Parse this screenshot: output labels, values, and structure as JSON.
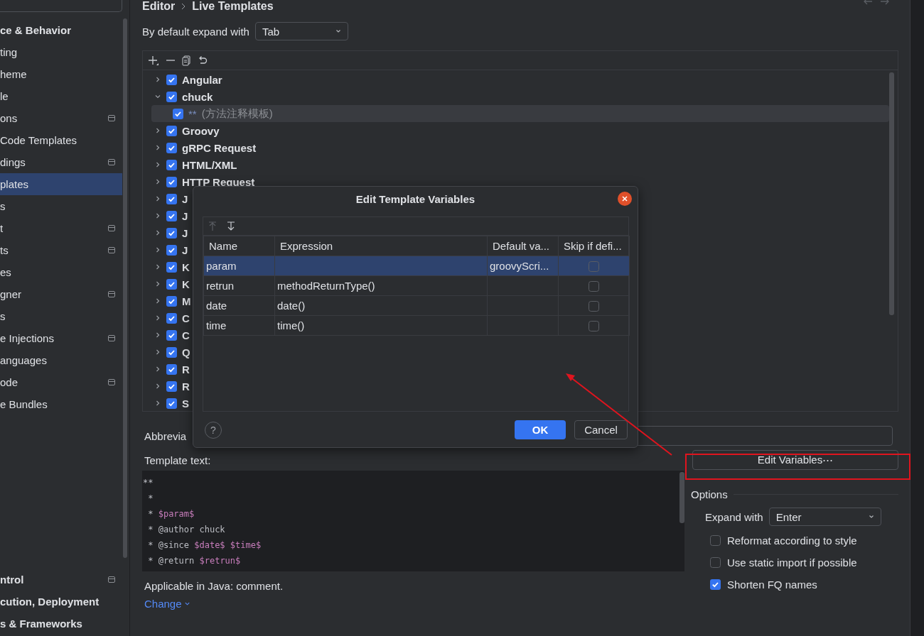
{
  "sidebar": {
    "items": [
      {
        "label": "ce & Behavior",
        "kind": "section",
        "scoped": false,
        "selected": false
      },
      {
        "label": "ting",
        "kind": "item",
        "scoped": false,
        "selected": false
      },
      {
        "label": "heme",
        "kind": "item",
        "scoped": false,
        "selected": false
      },
      {
        "label": "le",
        "kind": "item",
        "scoped": false,
        "selected": false
      },
      {
        "label": "ons",
        "kind": "item",
        "scoped": true,
        "selected": false
      },
      {
        "label": "Code Templates",
        "kind": "item",
        "scoped": false,
        "selected": false
      },
      {
        "label": "dings",
        "kind": "item",
        "scoped": true,
        "selected": false
      },
      {
        "label": "plates",
        "kind": "item",
        "scoped": false,
        "selected": true
      },
      {
        "label": "s",
        "kind": "item",
        "scoped": false,
        "selected": false
      },
      {
        "label": "t",
        "kind": "item",
        "scoped": true,
        "selected": false
      },
      {
        "label": "ts",
        "kind": "item",
        "scoped": true,
        "selected": false
      },
      {
        "label": "es",
        "kind": "item",
        "scoped": false,
        "selected": false
      },
      {
        "label": "gner",
        "kind": "item",
        "scoped": true,
        "selected": false
      },
      {
        "label": "s",
        "kind": "item",
        "scoped": false,
        "selected": false
      },
      {
        "label": "e Injections",
        "kind": "item",
        "scoped": true,
        "selected": false
      },
      {
        "label": "anguages",
        "kind": "item",
        "scoped": false,
        "selected": false
      },
      {
        "label": "ode",
        "kind": "item",
        "scoped": true,
        "selected": false
      },
      {
        "label": "e Bundles",
        "kind": "item",
        "scoped": false,
        "selected": false
      }
    ],
    "footer_items": [
      {
        "label": "ntrol",
        "kind": "section",
        "scoped": true,
        "selected": false
      },
      {
        "label": "cution, Deployment",
        "kind": "section",
        "scoped": false,
        "selected": false
      },
      {
        "label": "s & Frameworks",
        "kind": "section",
        "scoped": false,
        "selected": false
      }
    ]
  },
  "breadcrumb": [
    "Editor",
    "Live Templates"
  ],
  "expand_default": {
    "label": "By default expand with",
    "value": "Tab"
  },
  "tree": {
    "groups": [
      {
        "label": "Angular",
        "checked": true,
        "expanded": false
      },
      {
        "label": "chuck",
        "checked": true,
        "expanded": true,
        "children": [
          {
            "abbreviation": "**",
            "description": "(方法注释模板)",
            "checked": true,
            "selected": true
          }
        ]
      },
      {
        "label": "Groovy",
        "checked": true,
        "expanded": false
      },
      {
        "label": "gRPC Request",
        "checked": true,
        "expanded": false
      },
      {
        "label": "HTML/XML",
        "checked": true,
        "expanded": false
      },
      {
        "label": "HTTP Request",
        "checked": true,
        "expanded": false
      },
      {
        "label": "J",
        "checked": true,
        "expanded": false
      },
      {
        "label": "J",
        "checked": true,
        "expanded": false
      },
      {
        "label": "J",
        "checked": true,
        "expanded": false
      },
      {
        "label": "J",
        "checked": true,
        "expanded": false
      },
      {
        "label": "K",
        "checked": true,
        "expanded": false
      },
      {
        "label": "K",
        "checked": true,
        "expanded": false
      },
      {
        "label": "M",
        "checked": true,
        "expanded": false
      },
      {
        "label": "C",
        "checked": true,
        "expanded": false
      },
      {
        "label": "C",
        "checked": true,
        "expanded": false
      },
      {
        "label": "Q",
        "checked": true,
        "expanded": false
      },
      {
        "label": "R",
        "checked": true,
        "expanded": false
      },
      {
        "label": "R",
        "checked": true,
        "expanded": false
      },
      {
        "label": "S",
        "checked": true,
        "expanded": false
      }
    ]
  },
  "abbreviation": {
    "label": "Abbrevia"
  },
  "template_text": {
    "label": "Template text:",
    "lines": [
      [
        {
          "kind": "text",
          "text": "**"
        }
      ],
      [
        {
          "kind": "text",
          "text": " *"
        }
      ],
      [
        {
          "kind": "text",
          "text": " * "
        },
        {
          "kind": "variable",
          "text": "$param$"
        }
      ],
      [
        {
          "kind": "text",
          "text": " * @author chuck"
        }
      ],
      [
        {
          "kind": "text",
          "text": " * @since "
        },
        {
          "kind": "variable",
          "text": "$date$"
        },
        {
          "kind": "variable",
          "text": " $time$"
        }
      ],
      [
        {
          "kind": "text",
          "text": " * @return "
        },
        {
          "kind": "variable",
          "text": "$retrun$"
        }
      ]
    ]
  },
  "applicable": "Applicable in Java: comment.",
  "change_link": "Change",
  "edit_variables_button": "Edit Variables⋯",
  "options": {
    "title": "Options",
    "expand_with": {
      "label": "Expand with",
      "value": "Enter"
    },
    "checkboxes": [
      {
        "label": "Reformat according to style",
        "checked": false
      },
      {
        "label": "Use static import if possible",
        "checked": false
      },
      {
        "label": "Shorten FQ names",
        "checked": true
      }
    ]
  },
  "dialog": {
    "title": "Edit Template Variables",
    "columns": [
      "Name",
      "Expression",
      "Default va...",
      "Skip if defi..."
    ],
    "rows": [
      {
        "name": "param",
        "expression": "",
        "default_value": "groovyScri...",
        "skip_if_defined": false,
        "selected": true
      },
      {
        "name": "retrun",
        "expression": "methodReturnType()",
        "default_value": "",
        "skip_if_defined": false,
        "selected": false
      },
      {
        "name": "date",
        "expression": "date()",
        "default_value": "",
        "skip_if_defined": false,
        "selected": false
      },
      {
        "name": "time",
        "expression": "time()",
        "default_value": "",
        "skip_if_defined": false,
        "selected": false
      }
    ],
    "help": "?",
    "ok": "OK",
    "cancel": "Cancel"
  }
}
